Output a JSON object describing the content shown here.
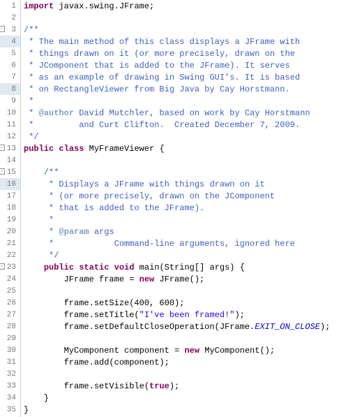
{
  "lines": [
    {
      "n": 1,
      "hl": false,
      "fold": "",
      "segs": [
        {
          "c": "kw",
          "t": "import"
        },
        {
          "c": "plain",
          "t": " javax.swing.JFrame;"
        }
      ]
    },
    {
      "n": 2,
      "hl": false,
      "fold": "",
      "segs": []
    },
    {
      "n": 3,
      "hl": false,
      "fold": "-",
      "segs": [
        {
          "c": "doc",
          "t": "/**"
        }
      ]
    },
    {
      "n": 4,
      "hl": true,
      "fold": "",
      "segs": [
        {
          "c": "doc",
          "t": " * The main method of this class displays a JFrame with"
        }
      ]
    },
    {
      "n": 5,
      "hl": false,
      "fold": "",
      "segs": [
        {
          "c": "doc",
          "t": " * things drawn on it (or more precisely, drawn on the"
        }
      ]
    },
    {
      "n": 6,
      "hl": false,
      "fold": "",
      "segs": [
        {
          "c": "doc",
          "t": " * JComponent that is added to the JFrame). It serves"
        }
      ]
    },
    {
      "n": 7,
      "hl": false,
      "fold": "",
      "segs": [
        {
          "c": "doc",
          "t": " * as an example of drawing in Swing GUI's. It is based"
        }
      ]
    },
    {
      "n": 8,
      "hl": true,
      "fold": "",
      "segs": [
        {
          "c": "doc",
          "t": " * on RectangleViewer from Big Java by Cay Horstmann."
        }
      ]
    },
    {
      "n": 9,
      "hl": false,
      "fold": "",
      "segs": [
        {
          "c": "doc",
          "t": " *"
        }
      ]
    },
    {
      "n": 10,
      "hl": false,
      "fold": "",
      "segs": [
        {
          "c": "doc",
          "t": " * "
        },
        {
          "c": "doctag",
          "t": "@author"
        },
        {
          "c": "doc",
          "t": " David Mutchler, based on work by Cay Horstmann"
        }
      ]
    },
    {
      "n": 11,
      "hl": false,
      "fold": "",
      "segs": [
        {
          "c": "doc",
          "t": " *         and Curt Clifton.  Created December 7, 2009."
        }
      ]
    },
    {
      "n": 12,
      "hl": false,
      "fold": "",
      "segs": [
        {
          "c": "doc",
          "t": " */"
        }
      ]
    },
    {
      "n": 13,
      "hl": false,
      "fold": "-",
      "segs": [
        {
          "c": "kw",
          "t": "public"
        },
        {
          "c": "plain",
          "t": " "
        },
        {
          "c": "kw",
          "t": "class"
        },
        {
          "c": "plain",
          "t": " MyFrameViewer {"
        }
      ]
    },
    {
      "n": 14,
      "hl": false,
      "fold": "",
      "segs": []
    },
    {
      "n": 15,
      "hl": false,
      "fold": "-",
      "segs": [
        {
          "c": "doc",
          "t": "    /**"
        }
      ]
    },
    {
      "n": 16,
      "hl": true,
      "fold": "",
      "segs": [
        {
          "c": "doc",
          "t": "     * Displays a JFrame with things drawn on it"
        }
      ]
    },
    {
      "n": 17,
      "hl": false,
      "fold": "",
      "segs": [
        {
          "c": "doc",
          "t": "     * (or more precisely, drawn on the JComponent"
        }
      ]
    },
    {
      "n": 18,
      "hl": false,
      "fold": "",
      "segs": [
        {
          "c": "doc",
          "t": "     * that is added to the JFrame)."
        }
      ]
    },
    {
      "n": 19,
      "hl": false,
      "fold": "",
      "segs": [
        {
          "c": "doc",
          "t": "     *"
        }
      ]
    },
    {
      "n": 20,
      "hl": false,
      "fold": "",
      "segs": [
        {
          "c": "doc",
          "t": "     * "
        },
        {
          "c": "doctag",
          "t": "@param"
        },
        {
          "c": "doc",
          "t": " args"
        }
      ]
    },
    {
      "n": 21,
      "hl": false,
      "fold": "",
      "segs": [
        {
          "c": "doc",
          "t": "     *            Command-line arguments, ignored here"
        }
      ]
    },
    {
      "n": 22,
      "hl": false,
      "fold": "",
      "segs": [
        {
          "c": "doc",
          "t": "     */"
        }
      ]
    },
    {
      "n": 23,
      "hl": false,
      "fold": "-",
      "segs": [
        {
          "c": "plain",
          "t": "    "
        },
        {
          "c": "kw",
          "t": "public"
        },
        {
          "c": "plain",
          "t": " "
        },
        {
          "c": "kw",
          "t": "static"
        },
        {
          "c": "plain",
          "t": " "
        },
        {
          "c": "kw",
          "t": "void"
        },
        {
          "c": "plain",
          "t": " main(String[] args) {"
        }
      ]
    },
    {
      "n": 24,
      "hl": false,
      "fold": "",
      "segs": [
        {
          "c": "plain",
          "t": "        JFrame frame = "
        },
        {
          "c": "kw",
          "t": "new"
        },
        {
          "c": "plain",
          "t": " JFrame();"
        }
      ]
    },
    {
      "n": 25,
      "hl": false,
      "fold": "",
      "segs": []
    },
    {
      "n": 26,
      "hl": false,
      "fold": "",
      "segs": [
        {
          "c": "plain",
          "t": "        frame.setSize(400, 600);"
        }
      ]
    },
    {
      "n": 27,
      "hl": false,
      "fold": "",
      "segs": [
        {
          "c": "plain",
          "t": "        frame.setTitle("
        },
        {
          "c": "str",
          "t": "\"I've been framed!\""
        },
        {
          "c": "plain",
          "t": ");"
        }
      ]
    },
    {
      "n": 28,
      "hl": false,
      "fold": "",
      "segs": [
        {
          "c": "plain",
          "t": "        frame.setDefaultCloseOperation(JFrame."
        },
        {
          "c": "const",
          "t": "EXIT_ON_CLOSE"
        },
        {
          "c": "plain",
          "t": ");"
        }
      ]
    },
    {
      "n": 29,
      "hl": false,
      "fold": "",
      "segs": []
    },
    {
      "n": 30,
      "hl": false,
      "fold": "",
      "segs": [
        {
          "c": "plain",
          "t": "        MyComponent component = "
        },
        {
          "c": "kw",
          "t": "new"
        },
        {
          "c": "plain",
          "t": " MyComponent();"
        }
      ]
    },
    {
      "n": 31,
      "hl": false,
      "fold": "",
      "segs": [
        {
          "c": "plain",
          "t": "        frame.add(component);"
        }
      ]
    },
    {
      "n": 32,
      "hl": false,
      "fold": "",
      "segs": []
    },
    {
      "n": 33,
      "hl": false,
      "fold": "",
      "segs": [
        {
          "c": "plain",
          "t": "        frame.setVisible("
        },
        {
          "c": "kw",
          "t": "true"
        },
        {
          "c": "plain",
          "t": ");"
        }
      ]
    },
    {
      "n": 34,
      "hl": false,
      "fold": "",
      "segs": [
        {
          "c": "plain",
          "t": "    }"
        }
      ]
    },
    {
      "n": 35,
      "hl": false,
      "fold": "",
      "segs": [
        {
          "c": "plain",
          "t": "}"
        }
      ]
    }
  ]
}
